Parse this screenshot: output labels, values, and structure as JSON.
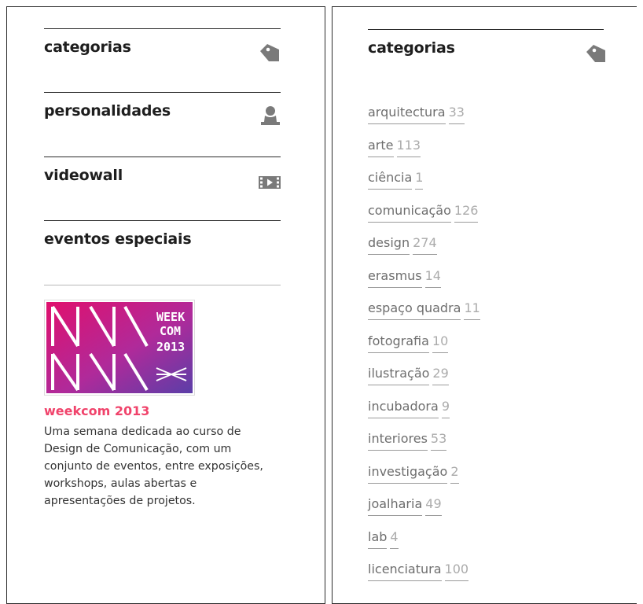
{
  "left": {
    "menu": [
      {
        "key": "categorias",
        "label": "categorias",
        "icon": "tag-icon"
      },
      {
        "key": "personalidades",
        "label": "personalidades",
        "icon": "person-icon"
      },
      {
        "key": "videowall",
        "label": "videowall",
        "icon": "video-icon"
      },
      {
        "key": "eventos",
        "label": "eventos especiais",
        "icon": ""
      }
    ],
    "event": {
      "logo_text": [
        "WEEK",
        "COM",
        "2013"
      ],
      "title": "weekcom 2013",
      "description": "Uma semana dedicada ao curso de Design de Comunicação, com um conjunto de eventos, entre exposições, workshops, aulas abertas e apresentações de projetos."
    }
  },
  "right": {
    "title": "categorias",
    "categories": [
      {
        "name": "arquitectura",
        "count": "33"
      },
      {
        "name": "arte",
        "count": "113"
      },
      {
        "name": "ciência",
        "count": "1"
      },
      {
        "name": "comunicação",
        "count": "126"
      },
      {
        "name": "design",
        "count": "274"
      },
      {
        "name": "erasmus",
        "count": "14"
      },
      {
        "name": "espaço quadra",
        "count": "11"
      },
      {
        "name": "fotografia",
        "count": "10"
      },
      {
        "name": "ilustração",
        "count": "29"
      },
      {
        "name": "incubadora",
        "count": "9"
      },
      {
        "name": "interiores",
        "count": "53"
      },
      {
        "name": "investigação",
        "count": "2"
      },
      {
        "name": "joalharia",
        "count": "49"
      },
      {
        "name": "lab",
        "count": "4"
      },
      {
        "name": "licenciatura",
        "count": "100"
      }
    ]
  },
  "colors": {
    "accent": "#f0436b",
    "icon": "#7a7a7a",
    "category_text": "#6e6e6e",
    "category_count": "#ababab"
  }
}
